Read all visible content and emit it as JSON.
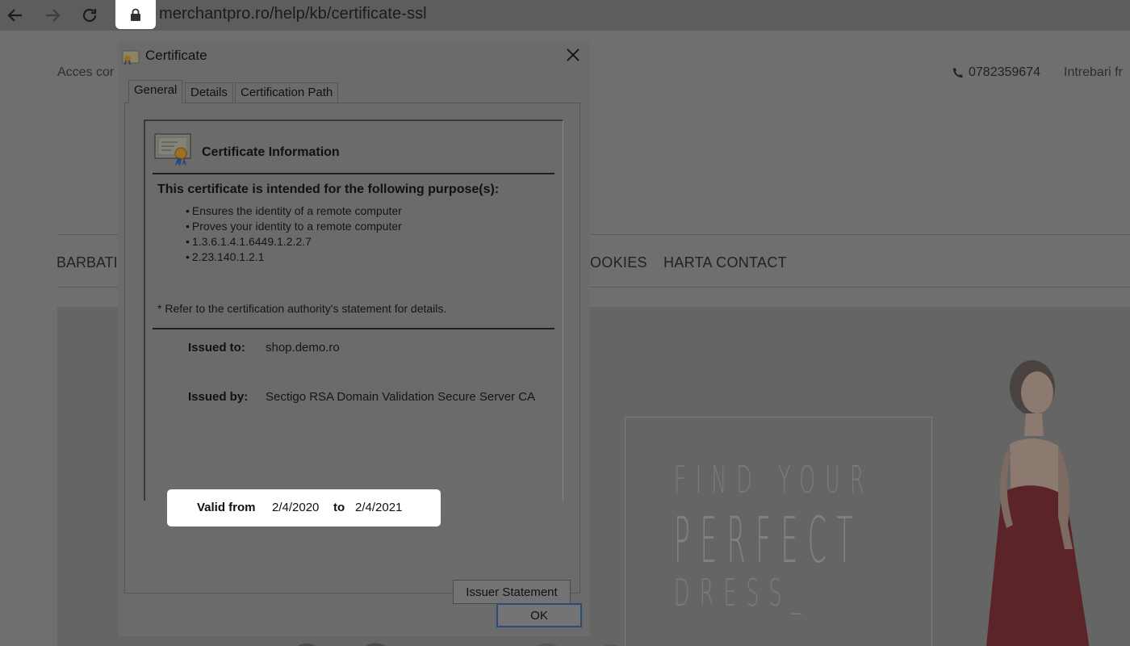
{
  "browser": {
    "url": "merchantpro.ro/help/kb/certificate-ssl"
  },
  "site": {
    "top_left_text": "Acces cor",
    "phone": "0782359674",
    "top_right_text": "Intrebari fr",
    "nav": {
      "barbati": "BARBATI",
      "cookies": "OOKIES",
      "harta": "HARTA CONTACT"
    },
    "hero": {
      "line1": "FIND YOUR",
      "line2": "PERFECT",
      "line3": "DRESS_"
    }
  },
  "dialog": {
    "title": "Certificate",
    "tabs": {
      "general": "General",
      "details": "Details",
      "path": "Certification Path"
    },
    "info_title": "Certificate Information",
    "purpose_heading": "This certificate is intended for the following purpose(s):",
    "purposes": {
      "p0": "Ensures the identity of a remote computer",
      "p1": "Proves your identity to a remote computer",
      "p2": "1.3.6.1.4.1.6449.1.2.2.7",
      "p3": "2.23.140.1.2.1"
    },
    "refer_note": "* Refer to the certification authority's statement for details.",
    "issued_to_label": "Issued to:",
    "issued_to_value": "shop.demo.ro",
    "issued_by_label": "Issued by:",
    "issued_by_value": "Sectigo RSA Domain Validation Secure Server CA",
    "valid_from_label": "Valid from",
    "valid_from_value": "2/4/2020",
    "valid_to_label": "to",
    "valid_to_value": "2/4/2021",
    "issuer_statement_button": "Issuer Statement",
    "ok_button": "OK"
  },
  "colors": {
    "overlay_bg": "#6f6f6f",
    "highlight": "#ffffff",
    "ok_border": "#2a4d77"
  }
}
